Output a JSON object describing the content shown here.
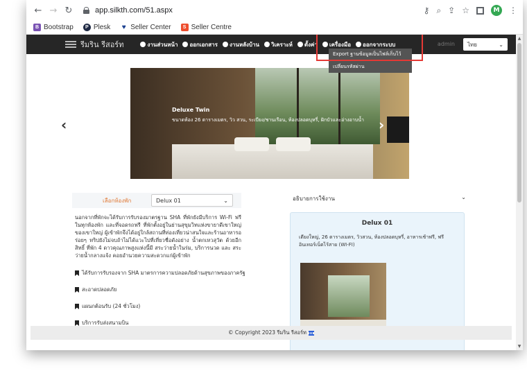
{
  "browser": {
    "url": "app.silkth.com/51.aspx",
    "avatar_initial": "M",
    "bookmarks": [
      {
        "label": "Bootstrap",
        "icon": "bootstrap-icon",
        "color": "#7952b3",
        "glyph": "B"
      },
      {
        "label": "Plesk",
        "icon": "plesk-icon",
        "color": "#1f2a44",
        "glyph": "P"
      },
      {
        "label": "Seller Center",
        "icon": "heart-icon",
        "color": "#1a3f8f",
        "glyph": "♥"
      },
      {
        "label": "Seller Centre",
        "icon": "shopee-icon",
        "color": "#ee4d2d",
        "glyph": "S"
      }
    ]
  },
  "nav": {
    "brand": "รีมริน รีสอร์ท",
    "menu": [
      "งานส่วนหน้า",
      "ออกเอกสาร",
      "งานหลังบ้าน",
      "วิเคราะห์",
      "ตั้งค่า",
      "เครื่องมือ",
      "ออกจากระบบ"
    ],
    "admin": "admin",
    "language": "ไทย",
    "dropdown": [
      "Export ฐานข้อมูลเป็นไฟล์เก็บไว้",
      "เปลี่ยนรหัสผ่าน"
    ]
  },
  "hero": {
    "title": "Deluxe Twin",
    "description": "ขนาดห้อง 26 ตารางเมตร, วิว สวน, ระเบียง/ชานเรือน, ห้องปลอดบุหรี่, ฝักบัวและอ่างอาบน้ำ"
  },
  "room_select": {
    "label": "เลือกห้องพัก",
    "value": "Delux 01"
  },
  "description": "นอกจากที่พักจะได้รับการรับรองมาตรฐาน SHA ที่พักยังมีบริการ Wi-Fi ฟรีในทุกห้องพัก และที่จอดรถฟรี ที่พักตั้งอยู่ในย่านสุขุมวิทแห่งขายาดีเขาใหญ่ของเขาใหญ่ ผู้เข้าพักจึงได้อยู่ใกล้สถานที่ท่องเที่ยวน่าสนใจและร้านอาหารอร่อยๆ ทริปยังไม่จบถ้าไม่ได้แวะไปที่เที่ยวชื่อดังอย่าง น้ำตกเหวสุวัต ด้วยอีกสิทธิ์ ที่พัก 4 ดาวคุณภาพสูงแห่งนี้มี สระว่ายน้ำในร่ม, บริการนวด และ สระว่ายน้ำกลางแจ้ง คอยอำนวยความสะดวกแก่ผู้เข้าพัก",
  "features": [
    "ได้รับการรับรองจาก SHA มาตรการความปลอดภัยด้านสุขภาพของภาครัฐ",
    "สะอาดปลอดภัย",
    "แผนกต้อนรับ (24 ชั่วโมง)",
    "บริการรับส่งสนามบิน"
  ],
  "usage": {
    "label": "อธิบายการใช้งาน"
  },
  "room_card": {
    "title": "Delux 01",
    "description": "เตียงใหญ่, 26 ตารางเมตร, วิวสวน, ห้องปลอดบุหรี่, อาหารเช้าฟรี, ฟรีอินเทอร์เน็ตไร้สาย (WI-FI)"
  },
  "footer": {
    "text": "© Copyright 2023 รีมริน รีสอร์ท"
  }
}
